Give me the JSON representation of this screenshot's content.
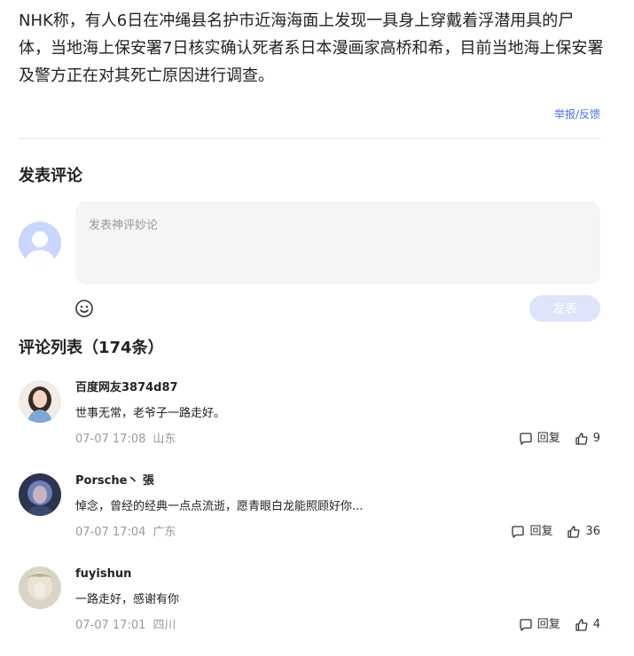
{
  "article": {
    "text": "NHK称，有人6日在冲绳县名护市近海海面上发现一具身上穿戴着浮潜用具的尸体，当地海上保安署7日核实确认死者系日本漫画家高桥和希，目前当地海上保安署及警方正在对其死亡原因进行调查。",
    "report_link": "举报/反馈"
  },
  "post_comment": {
    "title": "发表评论",
    "placeholder": "发表神评妙论",
    "submit_label": "发表",
    "emoji_icon": "smiley-icon"
  },
  "comment_list": {
    "title": "评论列表（174条）",
    "reply_label": "回复",
    "comments": [
      {
        "user": "百度网友3874d87",
        "text": "世事无常，老爷子一路走好。",
        "time": "07-07 17:08",
        "location": "山东",
        "likes": "9"
      },
      {
        "user": "Porsche丶 張",
        "text": "悼念，曾经的经典一点点流逝，愿青眼白龙能照顾好你...",
        "time": "07-07 17:04",
        "location": "广东",
        "likes": "36"
      },
      {
        "user": "fuyishun",
        "text": "一路走好，感谢有你",
        "time": "07-07 17:01",
        "location": "四川",
        "likes": "4"
      }
    ]
  },
  "colors": {
    "link": "#4e6ef2",
    "submit_disabled": "#dfe4fb",
    "meta_text": "#9a9a9a",
    "input_bg": "#f5f5f6"
  }
}
